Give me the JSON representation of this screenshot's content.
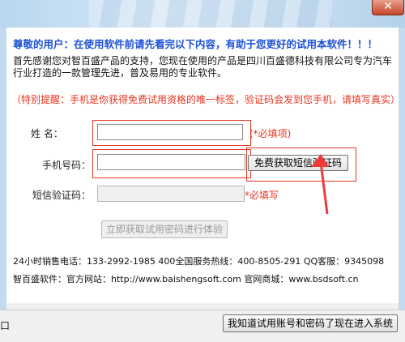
{
  "window": {
    "close_glyph": "✕"
  },
  "notice": {
    "heading": "尊敬的用户：在使用软件前请先看完以下内容，有助于您更好的试用本软件！！！",
    "intro": "首先感谢您对智百盛产品的支持，您现在使用的产品是四川百盛德科技有限公司专为汽车行业打造的一款管理先进，普及易用的专业软件。",
    "warning": "（特别提醒：手机是你获得免费试用资格的唯一标签，验证码会发到您手机，请填写真实）"
  },
  "form": {
    "name_label": "姓    名：",
    "name_value": "",
    "name_required": "(*必填项)",
    "phone_label": "手机号码：",
    "phone_value": "",
    "sms_button": "免费获取短信验证码",
    "code_label": "短信验证码：",
    "code_value": "",
    "code_required": "*必填写",
    "submit_button": "立即获取试用密码进行体验"
  },
  "footer": {
    "contact_line": "24小时销售电话：133-2992-1985  400全国服务热线：400-8505-291 QQ客服：9345098",
    "site_line": "智百盛软件：官方网站：http://www.baishengsoft.com 官网商城：www.bsdsoft.cn"
  },
  "statusbar": {
    "left_text": "口",
    "enter_button": "我知道试用账号和密码了现在进入系统"
  },
  "colors": {
    "heading": "#1a4fd6",
    "warning": "#e8321e",
    "arrow": "#f03a3a"
  }
}
